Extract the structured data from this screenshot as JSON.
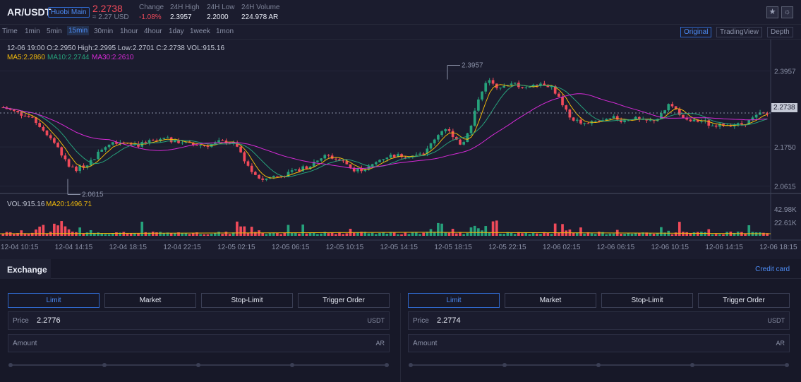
{
  "header": {
    "pair": "AR/USDT",
    "badge": "Huobi Main",
    "last_price": "2.2738",
    "usd_price": "≈ 2.27 USD",
    "stats": [
      {
        "label": "Change",
        "value": "-1.08%"
      },
      {
        "label": "24H High",
        "value": "2.3957"
      },
      {
        "label": "24H Low",
        "value": "2.2000"
      },
      {
        "label": "24H Volume",
        "value": "224.978 AR"
      }
    ]
  },
  "toolbar": {
    "timeframes": [
      "Time",
      "1min",
      "5min",
      "15min",
      "30min",
      "1hour",
      "4hour",
      "1day",
      "1week",
      "1mon"
    ],
    "active_timeframe": "15min",
    "views": [
      "Original",
      "TradingView",
      "Depth"
    ],
    "active_view": "Original"
  },
  "chart_data": {
    "type": "candlestick",
    "ohlc_readout": "12-06 19:00   O:2.2950  High:2.2995  Low:2.2701  C:2.2738  VOL:915.16",
    "ma_readout": [
      {
        "label": "MA5:2.2860",
        "color": "#f0b90b"
      },
      {
        "label": "MA10:2.2744",
        "color": "#26a17b"
      },
      {
        "label": "MA30:2.2610",
        "color": "#d62ad6"
      }
    ],
    "price_axis": [
      "2.3957",
      "2.2738",
      "2.1750",
      "2.0615"
    ],
    "vol_axis": [
      "42.98K",
      "22.61K"
    ],
    "vol_readout": [
      {
        "label": "VOL:915.16",
        "color": "#c4c8d6"
      },
      {
        "label": "MA20:1496.71",
        "color": "#f0b90b"
      }
    ],
    "current_price_tag": "2.2738",
    "annotations": {
      "high": "2.3957",
      "low": "2.0615"
    },
    "time_labels": [
      "12-04 10:15",
      "12-04 14:15",
      "12-04 18:15",
      "12-04 22:15",
      "12-05 02:15",
      "12-05 06:15",
      "12-05 10:15",
      "12-05 14:15",
      "12-05 18:15",
      "12-05 22:15",
      "12-06 02:15",
      "12-06 06:15",
      "12-06 10:15",
      "12-06 14:15",
      "12-06 18:15"
    ],
    "ylim": [
      2.04,
      2.45
    ],
    "close_path": [
      2.29,
      2.28,
      2.27,
      2.26,
      2.24,
      2.21,
      2.18,
      2.13,
      2.11,
      2.12,
      2.14,
      2.17,
      2.19,
      2.19,
      2.19,
      2.18,
      2.19,
      2.19,
      2.2,
      2.19,
      2.19,
      2.18,
      2.18,
      2.18,
      2.19,
      2.19,
      2.18,
      2.13,
      2.09,
      2.08,
      2.09,
      2.09,
      2.1,
      2.11,
      2.12,
      2.14,
      2.15,
      2.14,
      2.13,
      2.11,
      2.11,
      2.12,
      2.14,
      2.15,
      2.15,
      2.15,
      2.15,
      2.16,
      2.2,
      2.23,
      2.21,
      2.18,
      2.23,
      2.33,
      2.37,
      2.35,
      2.35,
      2.36,
      2.34,
      2.36,
      2.36,
      2.35,
      2.31,
      2.26,
      2.25,
      2.24,
      2.25,
      2.25,
      2.26,
      2.25,
      2.26,
      2.25,
      2.25,
      2.26,
      2.3,
      2.28,
      2.25,
      2.25,
      2.25,
      2.23,
      2.24,
      2.24,
      2.24,
      2.25,
      2.27,
      2.27
    ]
  },
  "exchange": {
    "tab_label": "Exchange",
    "credit_card": "Credit card",
    "order_types": [
      "Limit",
      "Market",
      "Stop-Limit",
      "Trigger Order"
    ],
    "buy": {
      "price_label": "Price",
      "price_value": "2.2776",
      "price_unit": "USDT",
      "amount_label": "Amount",
      "amount_unit": "AR"
    },
    "sell": {
      "price_label": "Price",
      "price_value": "2.2774",
      "price_unit": "USDT",
      "amount_label": "Amount",
      "amount_unit": "AR"
    }
  }
}
